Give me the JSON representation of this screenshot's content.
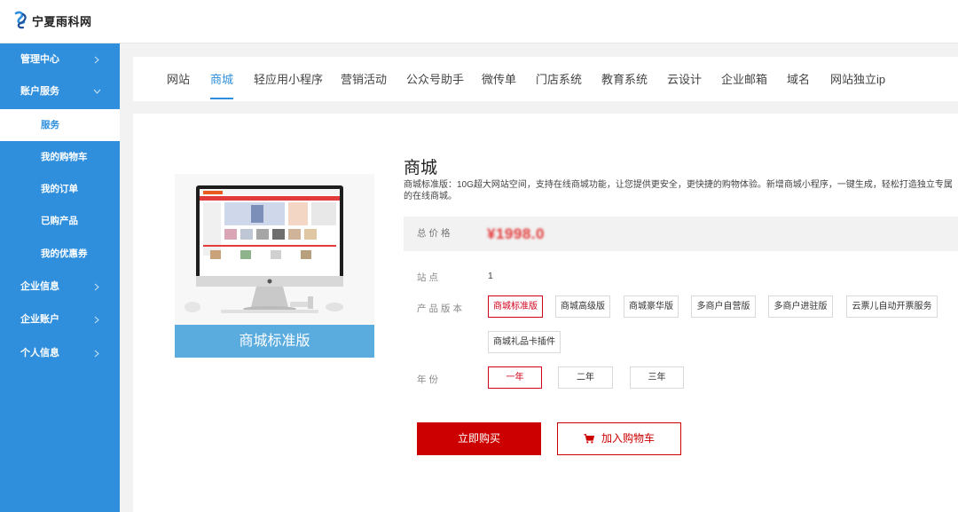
{
  "header": {
    "site_name": "宁夏雨科网"
  },
  "sidebar": {
    "items": [
      {
        "label": "管理中心",
        "expanded": false
      },
      {
        "label": "账户服务",
        "expanded": true
      },
      {
        "label": "企业信息",
        "expanded": false
      },
      {
        "label": "企业账户",
        "expanded": false
      },
      {
        "label": "个人信息",
        "expanded": false
      }
    ],
    "sub_items": [
      {
        "label": "服务",
        "active": true
      },
      {
        "label": "我的购物车",
        "active": false
      },
      {
        "label": "我的订单",
        "active": false
      },
      {
        "label": "已购产品",
        "active": false
      },
      {
        "label": "我的优惠券",
        "active": false
      }
    ]
  },
  "tabs": [
    {
      "label": "网站",
      "active": false
    },
    {
      "label": "商城",
      "active": true
    },
    {
      "label": "轻应用小程序",
      "active": false
    },
    {
      "label": "营销活动",
      "active": false
    },
    {
      "label": "公众号助手",
      "active": false
    },
    {
      "label": "微传单",
      "active": false
    },
    {
      "label": "门店系统",
      "active": false
    },
    {
      "label": "教育系统",
      "active": false
    },
    {
      "label": "云设计",
      "active": false
    },
    {
      "label": "企业邮箱",
      "active": false
    },
    {
      "label": "域名",
      "active": false
    },
    {
      "label": "网站独立ip",
      "active": false
    }
  ],
  "product": {
    "image_caption": "商城标准版",
    "title": "商城",
    "description": "商城标准版：10G超大网站空间，支持在线商城功能，让您提供更安全，更快捷的购物体验。新增商城小程序，一键生成，轻松打造独立专属的在线商城。",
    "price_label": "总价格",
    "price_value": "¥1998.0",
    "sites_label": "站点",
    "sites_value": "1",
    "version_label": "产品版本",
    "versions": [
      {
        "label": "商城标准版",
        "selected": true
      },
      {
        "label": "商城高级版",
        "selected": false
      },
      {
        "label": "商城豪华版",
        "selected": false
      },
      {
        "label": "多商户自营版",
        "selected": false
      },
      {
        "label": "多商户进驻版",
        "selected": false
      },
      {
        "label": "云票儿自动开票服务",
        "selected": false
      },
      {
        "label": "商城礼品卡插件",
        "selected": false
      }
    ],
    "years_label": "年份",
    "years": [
      {
        "label": "一年",
        "selected": true
      },
      {
        "label": "二年",
        "selected": false
      },
      {
        "label": "三年",
        "selected": false
      }
    ],
    "buy_label": "立即购买",
    "cart_label": "加入购物车"
  },
  "colors": {
    "sidebar_bg": "#2f8fdc",
    "accent": "#2f8fdc",
    "buy_red": "#cc0000",
    "price_red": "#e23b3b"
  }
}
